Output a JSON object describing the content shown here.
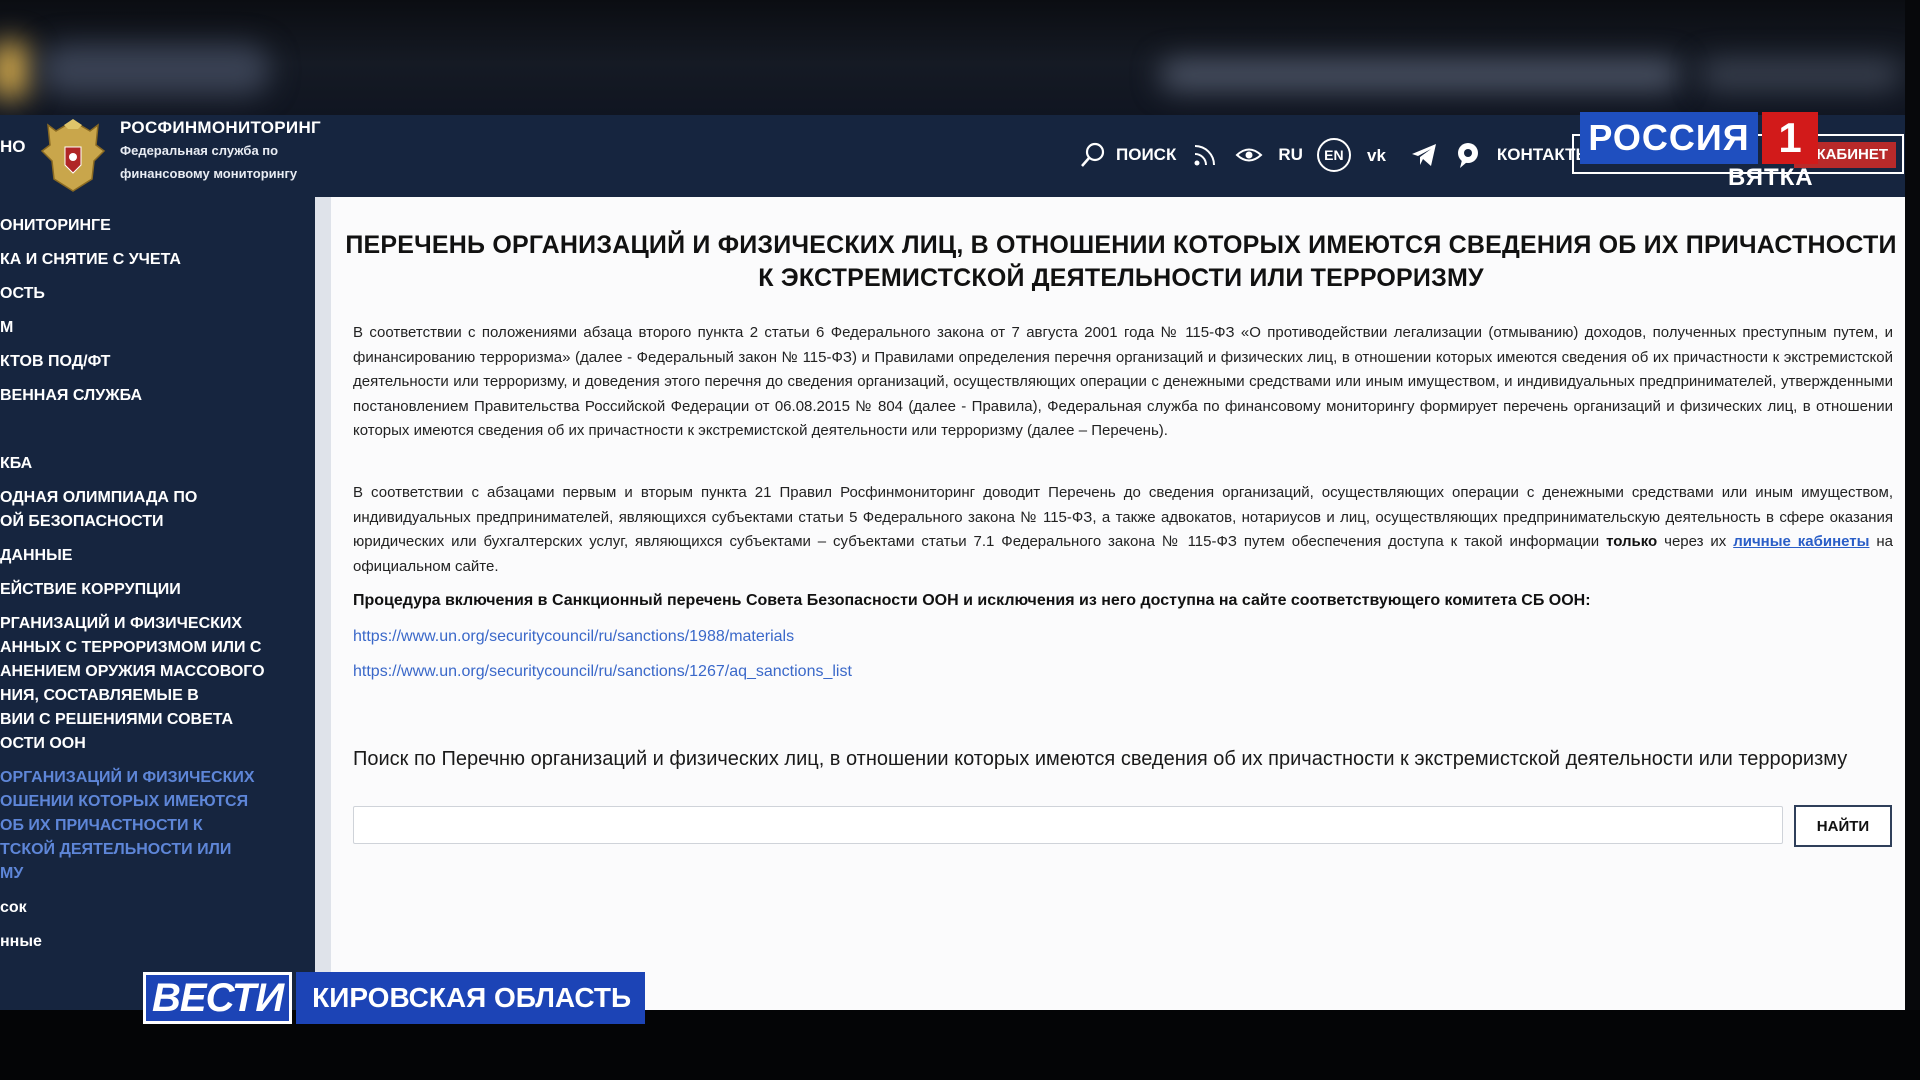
{
  "header": {
    "cut_label": "НО",
    "org_title": "РОСФИНМОНИТОРИНГ",
    "org_subtitle_1": "Федеральная служба по",
    "org_subtitle_2": "финансовому мониторингу",
    "search_label": "ПОИСК",
    "lang_ru": "RU",
    "lang_en": "EN",
    "vk_label": "VK",
    "contacts_label": "КОНТАКТЫ",
    "cabinet_label": "Й КАБИНЕТ"
  },
  "sidebar": {
    "items": [
      "ОНИТОРИНГЕ",
      "КА И СНЯТИЕ С УЧЕТА",
      "ОСТЬ",
      "М",
      "КТОВ ПОД/ФТ",
      "ВЕННАЯ СЛУЖБА",
      "КБА",
      "ОДНАЯ ОЛИМПИАДА ПО\nОЙ БЕЗОПАСНОСТИ",
      "ДАННЫЕ",
      "ЕЙСТВИЕ КОРРУПЦИИ",
      "РГАНИЗАЦИЙ И ФИЗИЧЕСКИХ\nАННЫХ С ТЕРРОРИЗМОМ ИЛИ С\nАНЕНИЕМ ОРУЖИЯ МАССОВОГО\nНИЯ, СОСТАВЛЯЕМЫЕ В\nВИИ С РЕШЕНИЯМИ СОВЕТА\nОСТИ ООН",
      "ОРГАНИЗАЦИЙ И ФИЗИЧЕСКИХ\nОШЕНИИ КОТОРЫХ ИМЕЮТСЯ\nОБ ИХ ПРИЧАСТНОСТИ К\nТСКОЙ ДЕЯТЕЛЬНОСТИ ИЛИ\nМУ",
      "сок",
      "нные"
    ]
  },
  "main": {
    "title_line1": "ПЕРЕЧЕНЬ ОРГАНИЗАЦИЙ И ФИЗИЧЕСКИХ ЛИЦ, В ОТНОШЕНИИ КОТОРЫХ ИМЕЮТСЯ СВЕДЕНИЯ ОБ ИХ ПРИЧАСТНОСТИ",
    "title_line2": "К ЭКСТРЕМИСТСКОЙ ДЕЯТЕЛЬНОСТИ ИЛИ ТЕРРОРИЗМУ",
    "para1": "В соответствии с положениями абзаца второго пункта 2 статьи 6 Федерального закона от 7 августа 2001 года № 115-ФЗ «О противодействии легализации (отмыванию) доходов, полученных преступным путем, и финансированию терроризма» (далее - Федеральный закон № 115-ФЗ) и Правилами определения перечня организаций и физических лиц, в отношении которых имеются сведения об их причастности к экстремистской деятельности или терроризму, и доведения этого перечня до сведения организаций, осуществляющих операции с денежными средствами или иным имуществом, и индивидуальных предпринимателей, утвержденными постановлением Правительства Российской Федерации от 06.08.2015 № 804 (далее - Правила), Федеральная служба по финансовому мониторингу формирует перечень организаций и физических лиц, в отношении которых имеются сведения об их причастности к экстремистской деятельности или терроризму (далее – Перечень).",
    "para2_start": "В соответствии с абзацами первым и вторым пункта 21 Правил Росфинмониторинг доводит Перечень до сведения организаций, осуществляющих операции с денежными средствами или иным имуществом, индивидуальных предпринимателей, являющихся субъектами статьи 5 Федерального закона № 115-ФЗ, а также адвокатов, нотариусов и лиц, осуществляющих предпринимательскую деятельность в сфере оказания юридических или бухгалтерских услуг, являющихся субъектами – субъектами статьи 7.1 Федерального закона № 115-ФЗ путем обеспечения доступа к такой информации ",
    "para2_bold": "только",
    "para2_mid": " через их ",
    "para2_link": "личные кабинеты",
    "para2_end": " на официальном сайте.",
    "un_note": "Процедура включения в Санкционный перечень Совета Безопасности ООН и исключения из него доступна на сайте соответствующего комитета СБ ООН:",
    "un_link1": "https://www.un.org/securitycouncil/ru/sanctions/1988/materials",
    "un_link2": "https://www.un.org/securitycouncil/ru/sanctions/1267/aq_sanctions_list",
    "search_label": "Поиск по Перечню организаций и физических лиц, в отношении которых имеются сведения об их причастности к экстремистской деятельности или терроризму",
    "search_value": "",
    "search_button": "НАЙТИ"
  },
  "tv": {
    "channel": "РОССИЯ",
    "channel_num": "1",
    "channel_region": "ВЯТКА",
    "news_logo": "ВЕСТИ",
    "news_region": "КИРОВСКАЯ ОБЛАСТЬ"
  }
}
